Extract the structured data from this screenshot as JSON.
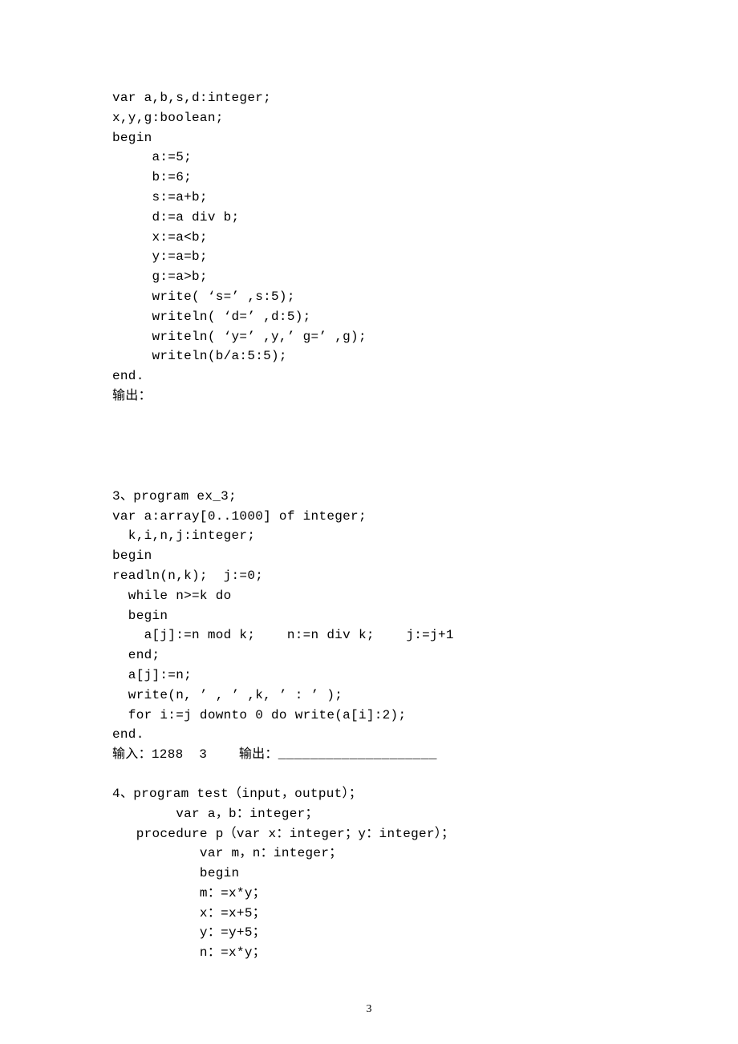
{
  "block1": {
    "lines": [
      "var a,b,s,d:integer;",
      "x,y,g:boolean;",
      "begin",
      "     a:=5;",
      "     b:=6;",
      "     s:=a+b;",
      "     d:=a div b;",
      "     x:=a<b;",
      "     y:=a=b;",
      "     g:=a>b;",
      "     write( ‘s=’ ,s:5);",
      "     writeln( ‘d=’ ,d:5);",
      "     writeln( ‘y=’ ,y,’ g=’ ,g);",
      "     writeln(b/a:5:5);",
      "end.",
      "输出："
    ]
  },
  "block2": {
    "lines": [
      "3、program ex_3;",
      "var a:array[0..1000] of integer;",
      "  k,i,n,j:integer;",
      "begin",
      "readln(n,k);  j:=0;",
      "  while n>=k do",
      "  begin",
      "    a[j]:=n mod k;    n:=n div k;    j:=j+1",
      "  end;",
      "  a[j]:=n;",
      "  write(n, ’ , ’ ,k, ’ : ’ );",
      "  for i:=j downto 0 do write(a[i]:2);",
      "end.",
      "输入：1288  3    输出：____________________"
    ]
  },
  "block3": {
    "lines": [
      "4、program test（input，output）；",
      "        var a，b：integer；",
      "   procedure p（var x：integer；y：integer）；",
      "           var m，n：integer；",
      "           begin",
      "           m：=x*y；",
      "           x：=x+5；",
      "           y：=y+5；",
      "           n：=x*y；"
    ]
  },
  "pageNumber": "3"
}
